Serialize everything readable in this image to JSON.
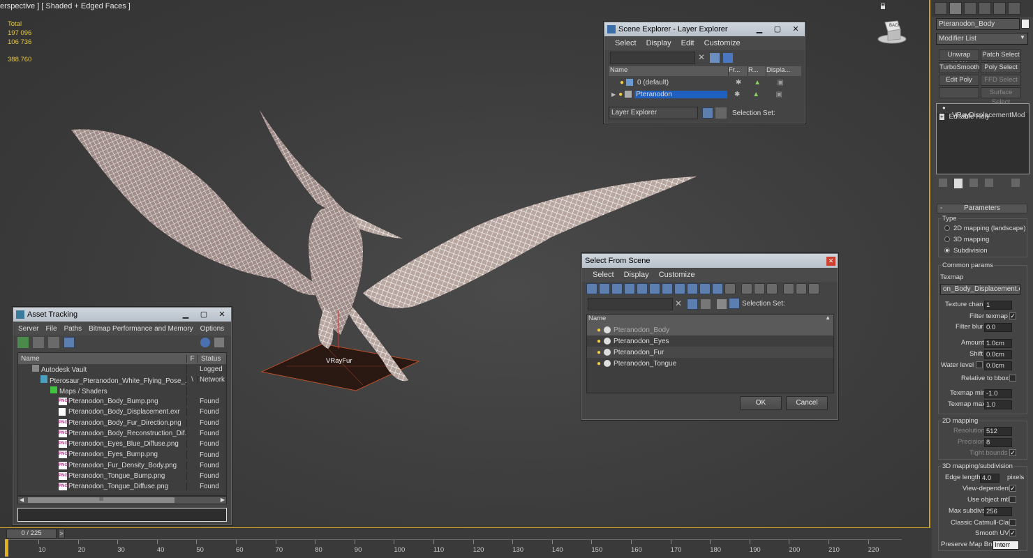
{
  "viewport": {
    "label": "erspective ] [ Shaded + Edged Faces ]",
    "stats": {
      "total_label": "Total",
      "polys": "197 096",
      "verts": "106 736",
      "fps": "388.760"
    },
    "fur_label": "VRayFur",
    "viewcube_label": "BACK"
  },
  "scene_explorer": {
    "title": "Scene Explorer - Layer Explorer",
    "menu": [
      "Select",
      "Display",
      "Edit",
      "Customize"
    ],
    "columns": [
      "Name",
      "Fr...",
      "R...",
      "Displa..."
    ],
    "rows": [
      {
        "name": "0 (default)",
        "selected": false
      },
      {
        "name": "Pteranodon",
        "selected": true
      }
    ],
    "footer_dropdown": "Layer Explorer",
    "selection_set_label": "Selection Set:"
  },
  "select_from_scene": {
    "title": "Select From Scene",
    "menu": [
      "Select",
      "Display",
      "Customize"
    ],
    "selection_set_label": "Selection Set:",
    "column_name": "Name",
    "items": [
      "Pteranodon_Body",
      "Pteranodon_Eyes",
      "Pteranodon_Fur",
      "Pteranodon_Tongue"
    ],
    "ok": "OK",
    "cancel": "Cancel"
  },
  "asset_tracking": {
    "title": "Asset Tracking",
    "menu": [
      "Server",
      "File",
      "Paths",
      "Bitmap Performance and Memory",
      "Options"
    ],
    "columns": [
      "Name",
      "F",
      "Status"
    ],
    "rows": [
      {
        "name": "Autodesk Vault",
        "f": "",
        "status": "Logged",
        "indent": 1,
        "icon": "vault"
      },
      {
        "name": "Pterosaur_Pteranodon_White_Flying_Pose_...",
        "f": "\\",
        "status": "Network",
        "indent": 2,
        "icon": "max"
      },
      {
        "name": "Maps / Shaders",
        "f": "",
        "status": "",
        "indent": 3,
        "icon": "maps"
      },
      {
        "name": "Pteranodon_Body_Bump.png",
        "f": "",
        "status": "Found",
        "indent": 4,
        "icon": "png"
      },
      {
        "name": "Pteranodon_Body_Displacement.exr",
        "f": "",
        "status": "Found",
        "indent": 4,
        "icon": "exr"
      },
      {
        "name": "Pteranodon_Body_Fur_Direction.png",
        "f": "",
        "status": "Found",
        "indent": 4,
        "icon": "png"
      },
      {
        "name": "Pteranodon_Body_Reconstruction_Dif...",
        "f": "",
        "status": "Found",
        "indent": 4,
        "icon": "png"
      },
      {
        "name": "Pteranodon_Eyes_Blue_Diffuse.png",
        "f": "",
        "status": "Found",
        "indent": 4,
        "icon": "png"
      },
      {
        "name": "Pteranodon_Eyes_Bump.png",
        "f": "",
        "status": "Found",
        "indent": 4,
        "icon": "png"
      },
      {
        "name": "Pteranodon_Fur_Density_Body.png",
        "f": "",
        "status": "Found",
        "indent": 4,
        "icon": "png"
      },
      {
        "name": "Pteranodon_Tongue_Bump.png",
        "f": "",
        "status": "Found",
        "indent": 4,
        "icon": "png"
      },
      {
        "name": "Pteranodon_Tongue_Diffuse.png",
        "f": "",
        "status": "Found",
        "indent": 4,
        "icon": "png"
      }
    ],
    "scroll_glyph": "III"
  },
  "command_panel": {
    "object_name": "Pteranodon_Body",
    "modifier_list": "Modifier List",
    "modifier_buttons": [
      "Unwrap UVW",
      "Patch Select",
      "TurboSmooth",
      "Poly Select",
      "Edit Poly",
      "FFD Select",
      "",
      "Surface Select"
    ],
    "stack": [
      "VRayDisplacementMod",
      "Editable Poly"
    ],
    "parameters_title": "Parameters",
    "type_label": "Type",
    "type_options": [
      "2D mapping (landscape)",
      "3D mapping",
      "Subdivision"
    ],
    "common_params": "Common params",
    "texmap_label": "Texmap",
    "texmap_value": "on_Body_Displacement.exr)",
    "texture_chan_label": "Texture chan",
    "texture_chan": "1",
    "filter_texmap_label": "Filter texmap",
    "filter_blur_label": "Filter blur",
    "filter_blur": "0.0",
    "amount_label": "Amount",
    "amount": "1.0cm",
    "shift_label": "Shift",
    "shift": "0.0cm",
    "water_level_label": "Water level",
    "water_level": "0.0cm",
    "relative_bbox_label": "Relative to bbox",
    "texmap_min_label": "Texmap min",
    "texmap_min": "-1.0",
    "texmap_max_label": "Texmap max",
    "texmap_max": "1.0",
    "mapping_2d": "2D mapping",
    "resolution_label": "Resolution",
    "resolution": "512",
    "precision_label": "Precision",
    "precision": "8",
    "tight_bounds_label": "Tight bounds",
    "mapping_3d": "3D mapping/subdivision",
    "edge_length_label": "Edge length",
    "edge_length": "4.0",
    "pixels_label": "pixels",
    "view_dependent_label": "View-dependent",
    "use_object_mtl_label": "Use object mtl",
    "max_subdivs_label": "Max subdivs",
    "max_subdivs": "256",
    "classic_cc_label": "Classic Catmull-Clark",
    "smooth_uvs_label": "Smooth UVs",
    "preserve_label": "Preserve Map Bnd",
    "preserve_value": "Interr"
  },
  "timeline": {
    "slider": "0 / 225",
    "arrow": ">",
    "ticks": [
      "10",
      "20",
      "30",
      "40",
      "50",
      "60",
      "70",
      "80",
      "90",
      "100",
      "110",
      "120",
      "130",
      "140",
      "150",
      "160",
      "170",
      "180",
      "190",
      "200",
      "210",
      "220"
    ]
  },
  "colors": {
    "selection_blue": "#1f5fbf",
    "stats_yellow": "#e8c840",
    "viewport_border": "#c9a227"
  }
}
